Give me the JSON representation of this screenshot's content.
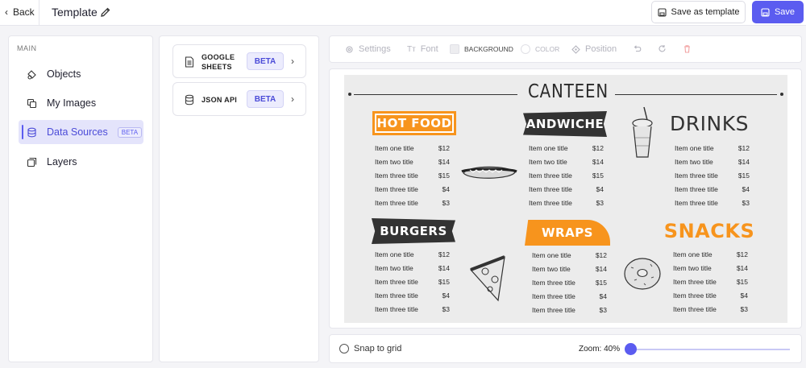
{
  "header": {
    "back_label": "Back",
    "title": "Template",
    "save_as_template_label": "Save as template",
    "save_label": "Save"
  },
  "sidebar": {
    "section_label": "MAIN",
    "items": [
      {
        "label": "Objects",
        "icon": "shapes-icon"
      },
      {
        "label": "My Images",
        "icon": "images-icon"
      },
      {
        "label": "Data Sources",
        "icon": "database-icon",
        "badge": "BETA",
        "active": true
      },
      {
        "label": "Layers",
        "icon": "layers-icon"
      }
    ]
  },
  "data_sources": [
    {
      "label_line1": "GOOGLE",
      "label_line2": "SHEETS",
      "badge": "BETA",
      "icon": "document-icon"
    },
    {
      "label_line1": "JSON API",
      "label_line2": "",
      "badge": "BETA",
      "icon": "database-icon"
    }
  ],
  "toolbar": {
    "settings": "Settings",
    "font": "Font",
    "background": "BACKGROUND",
    "color": "COLOR",
    "position": "Position"
  },
  "menu": {
    "title": "CANTEEN",
    "sections": [
      {
        "title": "HOT FOOD",
        "items": [
          {
            "name": "Item one title",
            "price": "$12"
          },
          {
            "name": "Item two title",
            "price": "$14"
          },
          {
            "name": "Item three title",
            "price": "$15"
          },
          {
            "name": "Item three title",
            "price": "$4"
          },
          {
            "name": "Item three title",
            "price": "$3"
          }
        ]
      },
      {
        "title": "SANDWICHES",
        "items": [
          {
            "name": "Item one title",
            "price": "$12"
          },
          {
            "name": "Item two title",
            "price": "$14"
          },
          {
            "name": "Item three title",
            "price": "$15"
          },
          {
            "name": "Item three title",
            "price": "$4"
          },
          {
            "name": "Item three title",
            "price": "$3"
          }
        ]
      },
      {
        "title": "DRINKS",
        "items": [
          {
            "name": "Item one title",
            "price": "$12"
          },
          {
            "name": "Item two title",
            "price": "$14"
          },
          {
            "name": "Item three title",
            "price": "$15"
          },
          {
            "name": "Item three title",
            "price": "$4"
          },
          {
            "name": "Item three title",
            "price": "$3"
          }
        ]
      },
      {
        "title": "BURGERS",
        "items": [
          {
            "name": "Item one title",
            "price": "$12"
          },
          {
            "name": "Item two title",
            "price": "$14"
          },
          {
            "name": "Item three title",
            "price": "$15"
          },
          {
            "name": "Item three title",
            "price": "$4"
          },
          {
            "name": "Item three title",
            "price": "$3"
          }
        ]
      },
      {
        "title": "WRAPS",
        "items": [
          {
            "name": "Item one title",
            "price": "$12"
          },
          {
            "name": "Item two title",
            "price": "$14"
          },
          {
            "name": "Item three title",
            "price": "$15"
          },
          {
            "name": "Item three title",
            "price": "$4"
          },
          {
            "name": "Item three title",
            "price": "$3"
          }
        ]
      },
      {
        "title": "SNACKS",
        "items": [
          {
            "name": "Item one title",
            "price": "$12"
          },
          {
            "name": "Item two title",
            "price": "$14"
          },
          {
            "name": "Item three title",
            "price": "$15"
          },
          {
            "name": "Item three title",
            "price": "$4"
          },
          {
            "name": "Item three title",
            "price": "$3"
          }
        ]
      }
    ]
  },
  "bottom": {
    "snap_label": "Snap to grid",
    "zoom_label": "Zoom: 40%",
    "zoom_value": 40
  },
  "colors": {
    "accent": "#5b5cf0",
    "menu_orange": "#f7941d",
    "menu_dark": "#333333"
  }
}
